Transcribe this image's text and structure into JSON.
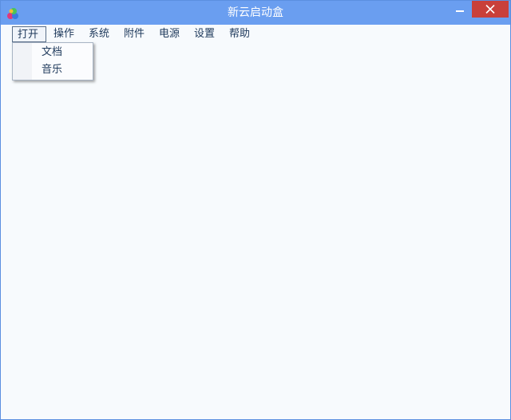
{
  "window": {
    "title": "新云启动盒"
  },
  "menubar": {
    "items": [
      "打开",
      "操作",
      "系统",
      "附件",
      "电源",
      "设置",
      "帮助"
    ],
    "open_index": 0
  },
  "dropdown": {
    "items": [
      "文档",
      "音乐"
    ]
  },
  "colors": {
    "titlebar": "#6a9ef0",
    "close": "#c9403a",
    "menu_text": "#1e395b",
    "client_bg": "#f7fafd"
  }
}
